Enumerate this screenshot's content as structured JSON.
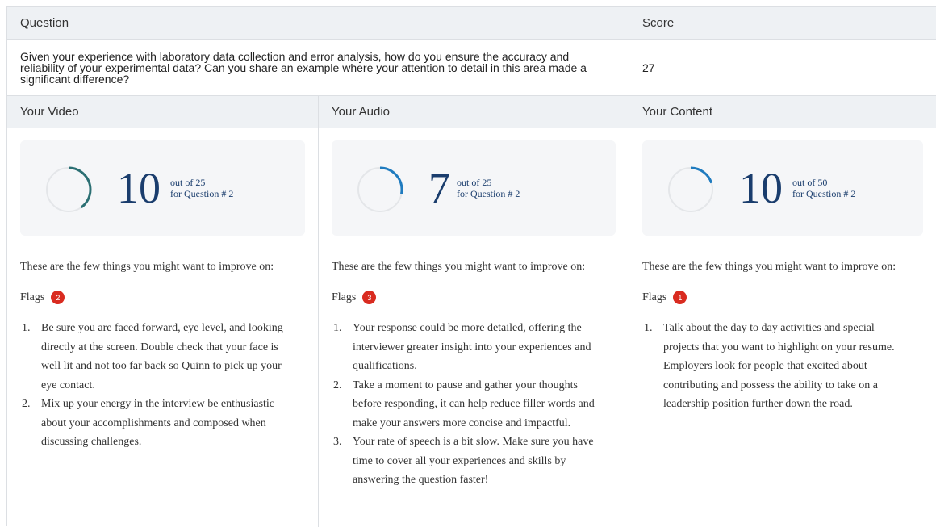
{
  "headers": {
    "question": "Question",
    "score": "Score"
  },
  "question": {
    "text": "Given your experience with laboratory data collection and error analysis, how do you ensure the accuracy and reliability of your experimental data? Can you share an example where your attention to detail in this area made a significant difference?",
    "score": "27"
  },
  "sections": [
    {
      "title": "Your Video",
      "score": "10",
      "out_of": "out of 25",
      "for_question": "for Question #  2",
      "progress_fraction": 0.4,
      "improve_text": "These are the few things you might want to improve on:",
      "flags_label": "Flags",
      "flags_count": "2",
      "tips": [
        "Be sure you are faced forward, eye level, and looking directly at the screen. Double check that your face is well lit and not too far back so Quinn to pick up your eye contact.",
        "Mix up your energy in the interview be enthusiastic about your accomplishments and composed when discussing challenges."
      ]
    },
    {
      "title": "Your Audio",
      "score": "7",
      "out_of": "out of 25",
      "for_question": "for Question #  2",
      "progress_fraction": 0.28,
      "improve_text": "These are the few things you might want to improve on:",
      "flags_label": "Flags",
      "flags_count": "3",
      "tips": [
        "Your response could be more detailed, offering the interviewer greater insight into your experiences and qualifications.",
        "Take a moment to pause and gather your thoughts before responding, it can help reduce filler words and make your answers more concise and impactful.",
        "Your rate of speech is a bit slow. Make sure you have time to cover all your experiences and skills by answering the question faster!"
      ]
    },
    {
      "title": "Your Content",
      "score": "10",
      "out_of": "out of 50",
      "for_question": "for Question #  2",
      "progress_fraction": 0.2,
      "improve_text": "These are the few things you might want to improve on:",
      "flags_label": "Flags",
      "flags_count": "1",
      "tips": [
        "Talk about the day to day activities and special projects that you want to highlight on your resume. Employers look for people that excited about contributing and possess the ability to take on a leadership position further down the road."
      ]
    }
  ],
  "colors": {
    "ring_track": "#e4e6e9",
    "ring_fill": "#1f7bbf",
    "ring_fill_dark": "#2b6f73",
    "badge": "#d92b20",
    "score_text": "#1a3d6d"
  }
}
